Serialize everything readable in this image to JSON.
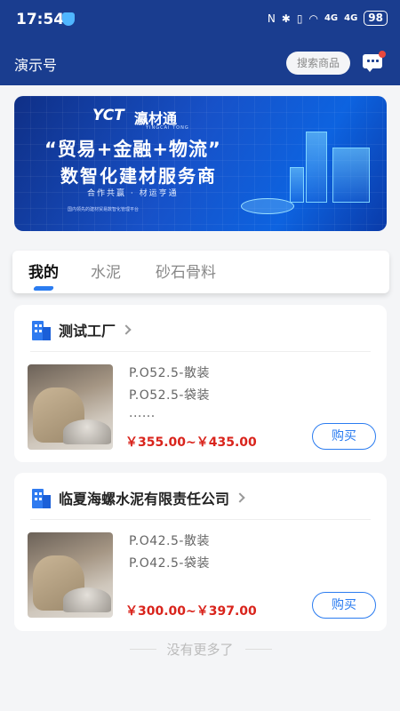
{
  "status_bar": {
    "time": "17:54",
    "signal1": "4G",
    "signal2": "4G",
    "battery": "98"
  },
  "header": {
    "title": "演示号",
    "search_label": "搜索商品",
    "message_icon": "chat-icon"
  },
  "banner": {
    "logo": "YCT",
    "logo_cn": "瀛材通",
    "logo_sub": "YINGCAI TONG",
    "headline": "“贸易+金融+物流”",
    "subheadline": "数智化建材服务商",
    "slogan": "合作共赢 · 材运亨通",
    "footnote": "国内领先的建材贸易数智化管理平台"
  },
  "tabs": [
    {
      "label": "我的",
      "active": true
    },
    {
      "label": "水泥",
      "active": false
    },
    {
      "label": "砂石骨料",
      "active": false
    }
  ],
  "shops": [
    {
      "name": "测试工厂",
      "specs": [
        "P.O52.5-散装",
        "P.O52.5-袋装",
        "......"
      ],
      "price": "￥355.00~￥435.00",
      "buy_label": "购买"
    },
    {
      "name": "临夏海螺水泥有限责任公司",
      "specs": [
        "P.O42.5-散装",
        "P.O42.5-袋装"
      ],
      "price": "￥300.00~￥397.00",
      "buy_label": "购买"
    }
  ],
  "footer": {
    "no_more": "没有更多了"
  },
  "colors": {
    "header_bg": "#1a3d8f",
    "accent": "#2b7cf0",
    "price": "#d9241c"
  }
}
